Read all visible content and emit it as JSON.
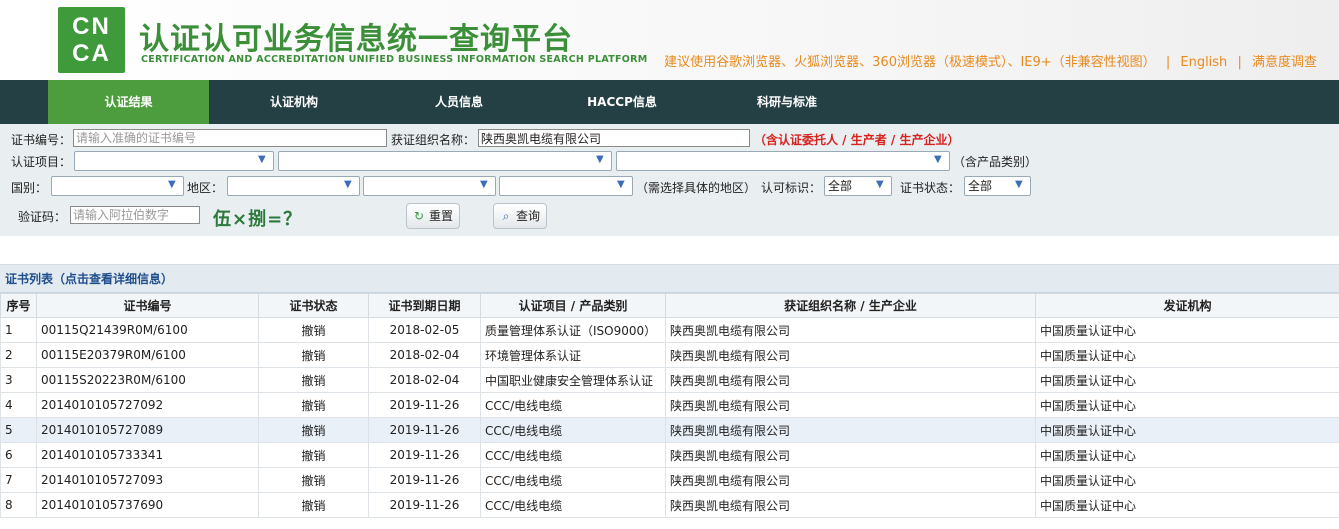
{
  "header": {
    "logo_text_1": "CN",
    "logo_text_2": "CA",
    "title_cn": "认证认可业务信息统一查询平台",
    "title_en": "CERTIFICATION AND ACCREDITATION UNIFIED BUSINESS INFORMATION SEARCH PLATFORM",
    "browser_note": "建议使用谷歌浏览器、火狐浏览器、360浏览器（极速模式）、IE9+（非兼容性视图）",
    "english_link": "English",
    "survey_link": "满意度调查",
    "sep": "|"
  },
  "nav": {
    "items": [
      {
        "label": "认证结果"
      },
      {
        "label": "认证机构"
      },
      {
        "label": "人员信息"
      },
      {
        "label": "HACCP信息"
      },
      {
        "label": "科研与标准"
      }
    ]
  },
  "form": {
    "cert_no_label": "证书编号：",
    "cert_no_placeholder": "请输入准确的证书编号",
    "org_label": "获证组织名称：",
    "org_value": "陕西奥凯电缆有限公司",
    "org_note": "（含认证委托人 / 生产者 / 生产企业）",
    "project_label": "认证项目：",
    "product_note": "（含产品类别）",
    "country_label": "国别：",
    "region_label": "地区：",
    "region_note": "（需选择具体的地区）",
    "accred_label": "认可标识：",
    "accred_value": "全部",
    "status_label": "证书状态：",
    "status_value": "全部",
    "captcha_label": "验证码：",
    "captcha_placeholder": "请输入阿拉伯数字",
    "captcha_text": "伍×捌=？",
    "reset_label": "重置",
    "search_label": "查询"
  },
  "list": {
    "title": "证书列表（点击查看详细信息）",
    "columns": [
      "序号",
      "证书编号",
      "证书状态",
      "证书到期日期",
      "认证项目 / 产品类别",
      "获证组织名称 / 生产企业",
      "发证机构"
    ],
    "rows": [
      [
        "1",
        "00115Q21439R0M/6100",
        "撤销",
        "2018-02-05",
        "质量管理体系认证（ISO9000）",
        "陕西奥凯电缆有限公司",
        "中国质量认证中心"
      ],
      [
        "2",
        "00115E20379R0M/6100",
        "撤销",
        "2018-02-04",
        "环境管理体系认证",
        "陕西奥凯电缆有限公司",
        "中国质量认证中心"
      ],
      [
        "3",
        "00115S20223R0M/6100",
        "撤销",
        "2018-02-04",
        "中国职业健康安全管理体系认证",
        "陕西奥凯电缆有限公司",
        "中国质量认证中心"
      ],
      [
        "4",
        "2014010105727092",
        "撤销",
        "2019-11-26",
        "CCC/电线电缆",
        "陕西奥凯电缆有限公司",
        "中国质量认证中心"
      ],
      [
        "5",
        "2014010105727089",
        "撤销",
        "2019-11-26",
        "CCC/电线电缆",
        "陕西奥凯电缆有限公司",
        "中国质量认证中心"
      ],
      [
        "6",
        "2014010105733341",
        "撤销",
        "2019-11-26",
        "CCC/电线电缆",
        "陕西奥凯电缆有限公司",
        "中国质量认证中心"
      ],
      [
        "7",
        "2014010105727093",
        "撤销",
        "2019-11-26",
        "CCC/电线电缆",
        "陕西奥凯电缆有限公司",
        "中国质量认证中心"
      ],
      [
        "8",
        "2014010105737690",
        "撤销",
        "2019-11-26",
        "CCC/电线电缆",
        "陕西奥凯电缆有限公司",
        "中国质量认证中心"
      ]
    ]
  }
}
